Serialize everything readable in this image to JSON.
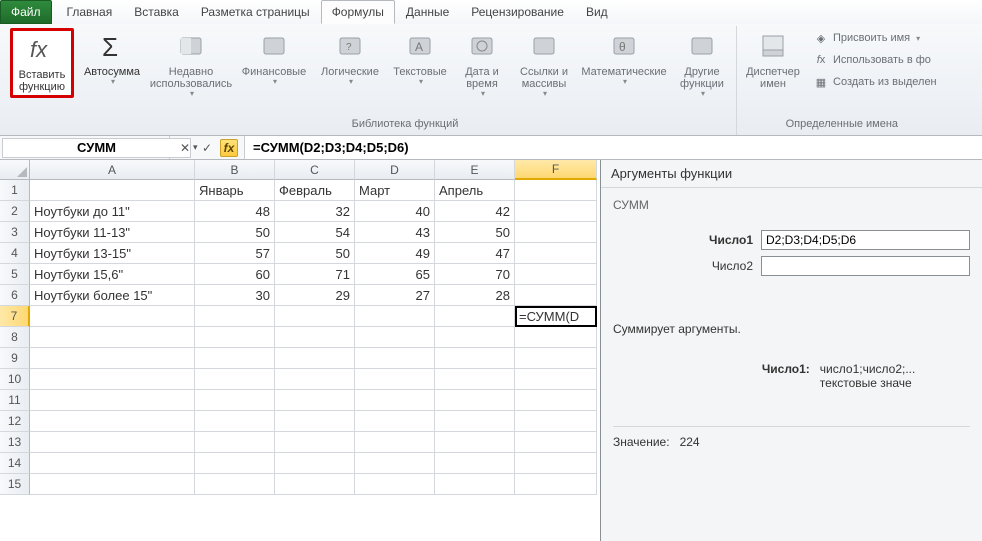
{
  "tabs": {
    "file": "Файл",
    "items": [
      "Главная",
      "Вставка",
      "Разметка страницы",
      "Формулы",
      "Данные",
      "Рецензирование",
      "Вид"
    ],
    "active_index": 3
  },
  "ribbon": {
    "insert_fn": "Вставить функцию",
    "autosum": "Автосумма",
    "recent": "Недавно использовались",
    "financial": "Финансовые",
    "logical": "Логические",
    "text": "Текстовые",
    "datetime": "Дата и время",
    "lookup": "Ссылки и массивы",
    "math": "Математические",
    "other": "Другие функции",
    "lib_group": "Библиотека функций",
    "name_mgr": "Диспетчер имен",
    "assign_name": "Присвоить имя",
    "use_in_formula": "Использовать в фо",
    "create_from_sel": "Создать из выделен",
    "names_group": "Определенные имена"
  },
  "formula_bar": {
    "name_box": "СУММ",
    "formula": "=СУММ(D2;D3;D4;D5;D6)"
  },
  "sheet": {
    "col_headers": [
      "A",
      "B",
      "C",
      "D",
      "E",
      "F"
    ],
    "row_headers": [
      "1",
      "2",
      "3",
      "4",
      "5",
      "6",
      "7",
      "8",
      "9",
      "10",
      "11",
      "12",
      "13",
      "14",
      "15"
    ],
    "header_row": [
      "",
      "Январь",
      "Февраль",
      "Март",
      "Апрель",
      ""
    ],
    "rows": [
      [
        "Ноутбуки до 11\"",
        "48",
        "32",
        "40",
        "42",
        ""
      ],
      [
        "Ноутбуки 11-13\"",
        "50",
        "54",
        "43",
        "50",
        ""
      ],
      [
        "Ноутбуки 13-15\"",
        "57",
        "50",
        "49",
        "47",
        ""
      ],
      [
        "Ноутбуки 15,6\"",
        "60",
        "71",
        "65",
        "70",
        ""
      ],
      [
        "Ноутбуки более 15\"",
        "30",
        "29",
        "27",
        "28",
        ""
      ]
    ],
    "formula_cell": "=СУММ(D",
    "selected_col": 5,
    "selected_row": 6
  },
  "dialog": {
    "title": "Аргументы функции",
    "fn_name": "СУММ",
    "arg1_label": "Число1",
    "arg1_value": "D2;D3;D4;D5;D6",
    "arg2_label": "Число2",
    "arg2_value": "",
    "desc": "Суммирует аргументы.",
    "argdesc_label": "Число1:",
    "argdesc_text": "число1;число2;... текстовые значе",
    "result_label": "Значение:",
    "result_value": "224"
  }
}
